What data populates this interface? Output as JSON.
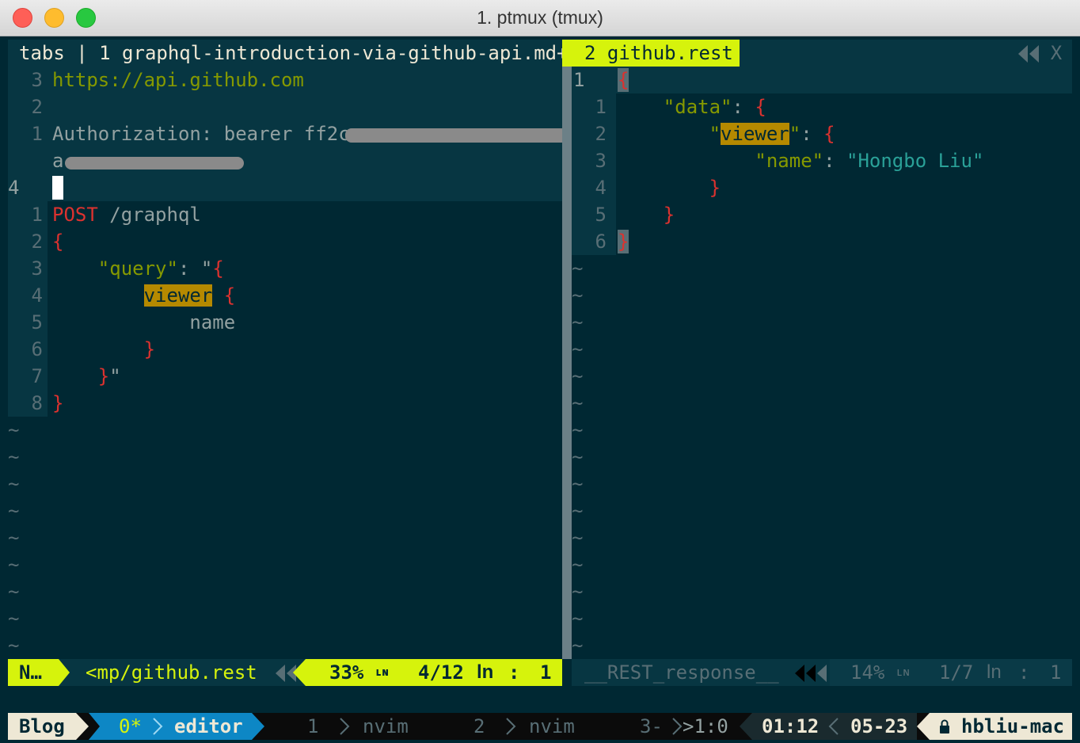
{
  "window": {
    "title": "1. ptmux (tmux)"
  },
  "tabline": {
    "left_label": "tabs | 1 graphql-introduction-via-github-api.md+",
    "active_tab": "2 github.rest",
    "close": "X"
  },
  "left_pane": {
    "header_lines": [
      {
        "num": "3",
        "text": "https://api.github.com"
      },
      {
        "num": "2",
        "text": ""
      },
      {
        "num": "1",
        "text": "Authorization: bearer ff2ce"
      },
      {
        "num": "",
        "text": "a"
      }
    ],
    "cursor_line_num": "4",
    "body_lines": [
      {
        "num": "1",
        "parts": [
          {
            "t": "POST",
            "c": "red"
          },
          {
            "t": " /graphql",
            "c": "fg"
          }
        ]
      },
      {
        "num": "2",
        "parts": [
          {
            "t": "{",
            "c": "red"
          }
        ]
      },
      {
        "num": "3",
        "parts": [
          {
            "t": "    ",
            "c": "fg"
          },
          {
            "t": "\"query\"",
            "c": "green"
          },
          {
            "t": ": \"",
            "c": "fg"
          },
          {
            "t": "{",
            "c": "red"
          }
        ]
      },
      {
        "num": "4",
        "parts": [
          {
            "t": "        ",
            "c": "fg"
          },
          {
            "t": "viewer",
            "c": "hl"
          },
          {
            "t": " ",
            "c": "fg"
          },
          {
            "t": "{",
            "c": "red"
          }
        ]
      },
      {
        "num": "5",
        "parts": [
          {
            "t": "            name",
            "c": "fg"
          }
        ]
      },
      {
        "num": "6",
        "parts": [
          {
            "t": "        ",
            "c": "fg"
          },
          {
            "t": "}",
            "c": "red"
          }
        ]
      },
      {
        "num": "7",
        "parts": [
          {
            "t": "    ",
            "c": "fg"
          },
          {
            "t": "}",
            "c": "red"
          },
          {
            "t": "\"",
            "c": "fg"
          }
        ]
      },
      {
        "num": "8",
        "parts": [
          {
            "t": "}",
            "c": "red"
          }
        ]
      }
    ],
    "tilde": "~"
  },
  "right_pane": {
    "lines": [
      {
        "num": "1",
        "parts": [
          {
            "t": "{",
            "c": "red"
          }
        ]
      },
      {
        "num": "1",
        "parts": [
          {
            "t": "    ",
            "c": "fg"
          },
          {
            "t": "\"data\"",
            "c": "green"
          },
          {
            "t": ": ",
            "c": "fg"
          },
          {
            "t": "{",
            "c": "red"
          }
        ]
      },
      {
        "num": "2",
        "parts": [
          {
            "t": "        \"",
            "c": "green"
          },
          {
            "t": "viewer",
            "c": "hl"
          },
          {
            "t": "\"",
            "c": "green"
          },
          {
            "t": ": ",
            "c": "fg"
          },
          {
            "t": "{",
            "c": "red"
          }
        ]
      },
      {
        "num": "3",
        "parts": [
          {
            "t": "            ",
            "c": "fg"
          },
          {
            "t": "\"name\"",
            "c": "green"
          },
          {
            "t": ": ",
            "c": "fg"
          },
          {
            "t": "\"Hongbo Liu\"",
            "c": "cyan"
          }
        ]
      },
      {
        "num": "4",
        "parts": [
          {
            "t": "        ",
            "c": "fg"
          },
          {
            "t": "}",
            "c": "red"
          }
        ]
      },
      {
        "num": "5",
        "parts": [
          {
            "t": "    ",
            "c": "fg"
          },
          {
            "t": "}",
            "c": "red"
          }
        ]
      },
      {
        "num": "6",
        "parts": [
          {
            "t": "}",
            "c": "red"
          }
        ]
      }
    ],
    "tilde": "~"
  },
  "statusline_left": {
    "mode": "N…",
    "file": "<mp/github.rest",
    "percent": "33%",
    "ln_icon": "ʟɴ",
    "pos": "4/12",
    "ln": "ln",
    "colon": ":",
    "col": "1"
  },
  "statusline_right": {
    "file": "__REST_response__",
    "percent": "14%",
    "ln_icon": "ʟɴ",
    "pos": "1/7",
    "ln": "ln",
    "colon": ":",
    "col": "1"
  },
  "tmux": {
    "session": "Blog",
    "current_index": "0*",
    "current_name": "editor",
    "windows": [
      {
        "index": "1",
        "name": "nvim"
      },
      {
        "index": "2",
        "name": "nvim"
      },
      {
        "index": "3-",
        "name": ">1:0"
      }
    ],
    "time": "01:12",
    "date": "05-23",
    "host": "hbliu-mac"
  },
  "colors": {
    "background": "#002833",
    "line_number_bg": "#073642",
    "accent_yellow": "#d6f30c",
    "highlight": "#b58900",
    "red": "#dc322f",
    "green": "#859900",
    "cyan": "#2aa198",
    "tmux_blue": "#0d87c5"
  }
}
